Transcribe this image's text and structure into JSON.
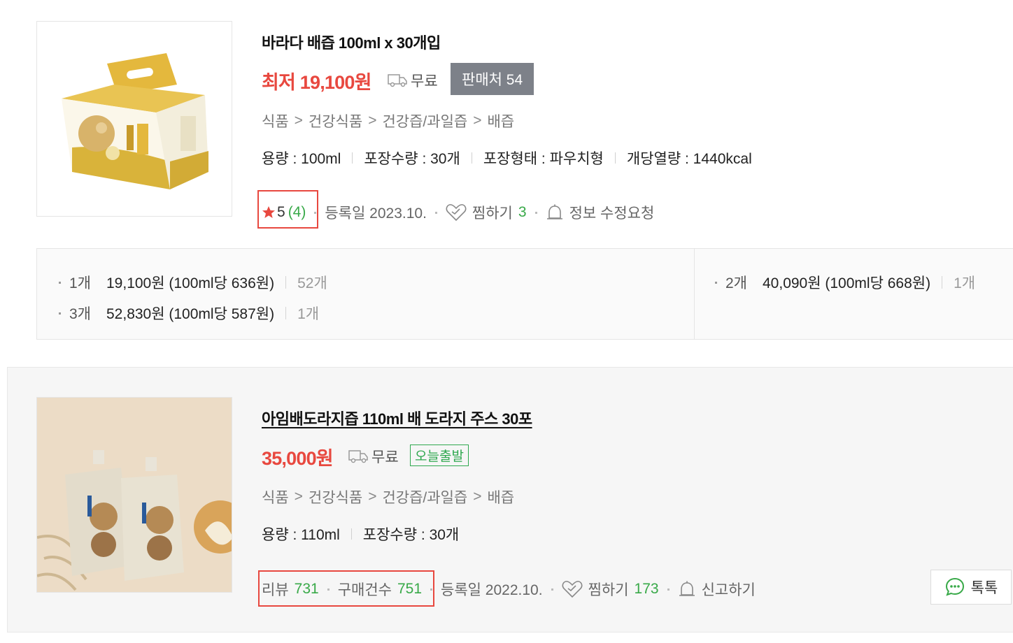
{
  "product1": {
    "title": "바라다 배즙 100ml x 30개입",
    "price_prefix": "최저",
    "price": "19,100원",
    "shipping": "무료",
    "seller_label": "판매처 54",
    "category": [
      "식품",
      "건강식품",
      "건강즙/과일즙",
      "배즙"
    ],
    "category_sep": ">",
    "specs": [
      "용량 : 100ml",
      "포장수량 : 30개",
      "포장형태 : 파우치형",
      "개당열량 : 1440kcal"
    ],
    "rating": "5",
    "rating_count": "(4)",
    "registered": "등록일 2023.10.",
    "wish_label": "찜하기",
    "wish_count": "3",
    "edit_request": "정보 수정요청",
    "quantity_options": [
      {
        "qty": "1개",
        "price": "19,100원 (100ml당 636원)",
        "sold": "52개"
      },
      {
        "qty": "3개",
        "price": "52,830원 (100ml당 587원)",
        "sold": "1개"
      },
      {
        "qty": "2개",
        "price": "40,090원 (100ml당 668원)",
        "sold": "1개"
      }
    ]
  },
  "product2": {
    "title": "아임배도라지즙 110ml 배 도라지 주스 30포",
    "price": "35,000원",
    "shipping": "무료",
    "badge": "오늘출발",
    "category": [
      "식품",
      "건강식품",
      "건강즙/과일즙",
      "배즙"
    ],
    "category_sep": ">",
    "specs": [
      "용량 : 110ml",
      "포장수량 : 30개"
    ],
    "review_label": "리뷰",
    "review_count": "731",
    "purchase_label": "구매건수",
    "purchase_count": "751",
    "registered": "등록일 2022.10.",
    "wish_label": "찜하기",
    "wish_count": "173",
    "report": "신고하기",
    "talk_label": "톡톡"
  },
  "colors": {
    "price_red": "#e8483f",
    "green": "#38a948",
    "seller_btn": "#7d8189"
  },
  "icons": [
    "truck-icon",
    "star-icon",
    "heart-icon",
    "bell-icon",
    "chat-icon"
  ]
}
